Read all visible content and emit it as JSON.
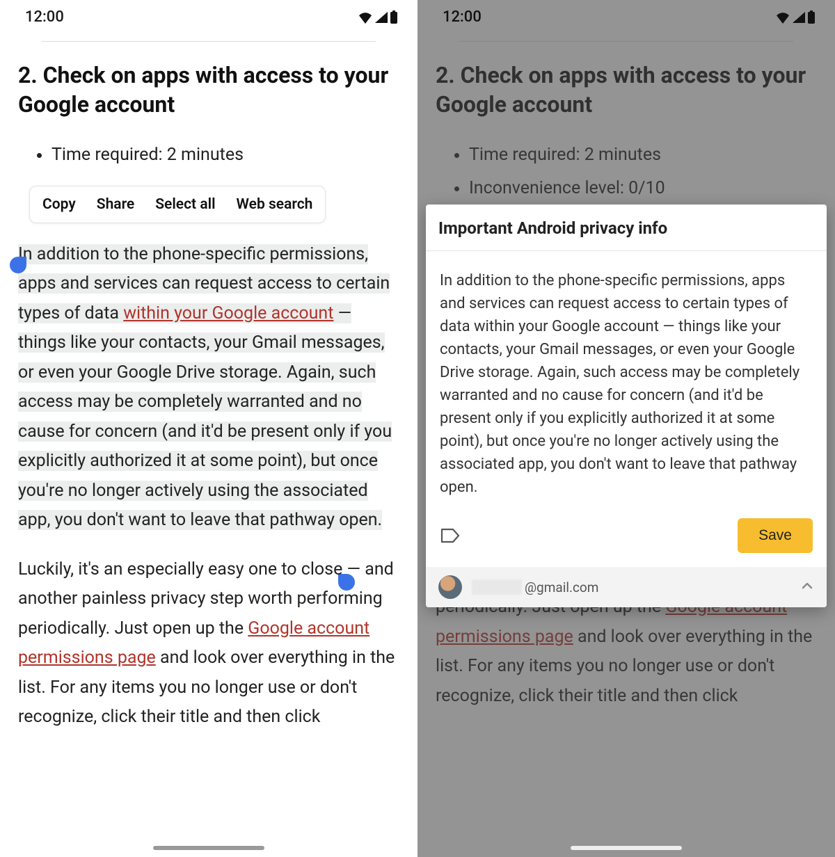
{
  "status": {
    "time": "12:00"
  },
  "article": {
    "heading": "2. Check on apps with access to your Google account",
    "bullet_time": "Time required: 2 minutes",
    "bullet_inconv": "Inconvenience level: 0/10",
    "para1_a": "In addition to the phone-specific permissions, apps and services can request access to certain types of data ",
    "link1": "within your Google account",
    "para1_b": " — things like your contacts, your Gmail messages, or even your Google Drive storage. Again, such access may be completely warranted and no cause for concern (and it'd be present only if you explicitly authorized it at some point), but once you're no longer actively using the associated app, you don't want to leave that pathway open.",
    "para2_a": "Luckily, it's an especially easy one to close — and another painless privacy step worth performing periodically. Just open up the ",
    "link2": "Google account permissions page",
    "para2_b": " and look over everything in the list. For any items you no longer use or don't recognize, click their title and then click"
  },
  "context_menu": {
    "copy": "Copy",
    "share": "Share",
    "select_all": "Select all",
    "web_search": "Web search"
  },
  "sheet": {
    "title": "Important Android privacy info",
    "body": "In addition to the phone-specific permissions, apps and services can request access to certain types of data within your Google account — things like your contacts, your Gmail messages, or even your Google Drive storage. Again, such access may be completely warranted and no cause for concern (and it'd be present only if you explicitly authorized it at some point), but once you're no longer actively using the associated app, you don't want to leave that pathway open.",
    "save": "Save",
    "email_suffix": "@gmail.com"
  }
}
